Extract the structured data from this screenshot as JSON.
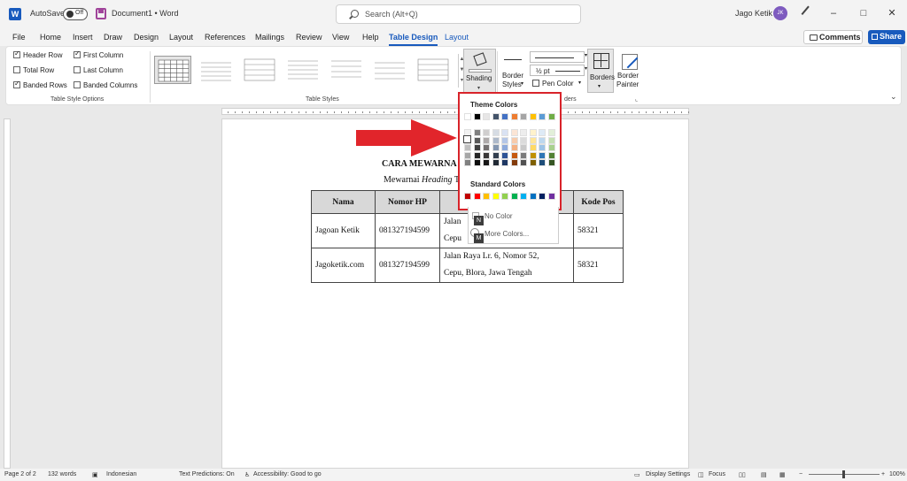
{
  "titlebar": {
    "app_logo": "W",
    "autosave_label": "AutoSave",
    "autosave_state": "Off",
    "document_title": "Document1 • Word",
    "search_placeholder": "Search (Alt+Q)",
    "user_name": "Jago Ketik",
    "user_initials": "JK",
    "minimize": "–",
    "maximize": "□",
    "close": "✕"
  },
  "tabs": [
    "File",
    "Home",
    "Insert",
    "Draw",
    "Design",
    "Layout",
    "References",
    "Mailings",
    "Review",
    "View",
    "Help",
    "Table Design",
    "Layout"
  ],
  "active_tab": "Table Design",
  "comments_label": "Comments",
  "share_label": "Share",
  "ribbon": {
    "style_options": {
      "items": [
        {
          "label": "Header Row",
          "checked": true
        },
        {
          "label": "Total Row",
          "checked": false
        },
        {
          "label": "Banded Rows",
          "checked": true
        },
        {
          "label": "First Column",
          "checked": true
        },
        {
          "label": "Last Column",
          "checked": false
        },
        {
          "label": "Banded Columns",
          "checked": false
        }
      ],
      "group_label": "Table Style Options"
    },
    "table_styles_label": "Table Styles",
    "shading_label": "Shading",
    "border_styles_label": "Border Styles",
    "border_styles_line1": "Border",
    "border_styles_line2": "Styles",
    "pen_weight": "½ pt",
    "pen_color_label": "Pen Color",
    "borders_label": "Borders",
    "border_painter_line1": "Border",
    "border_painter_line2": "Painter",
    "borders_group_label": "ders"
  },
  "color_menu": {
    "theme_colors_label": "Theme Colors",
    "standard_colors_label": "Standard Colors",
    "no_color_label": "No Color",
    "more_colors_label": "More Colors...",
    "keytip_n": "N",
    "keytip_m": "M",
    "theme_top_row": [
      "#ffffff",
      "#000000",
      "#e7e6e6",
      "#44546a",
      "#4472c4",
      "#ed7d31",
      "#a5a5a5",
      "#ffc000",
      "#5b9bd5",
      "#70ad47"
    ],
    "theme_columns": [
      [
        "#f2f2f2",
        "#d9d9d9",
        "#bfbfbf",
        "#a6a6a6",
        "#808080"
      ],
      [
        "#7f7f7f",
        "#595959",
        "#404040",
        "#262626",
        "#0d0d0d"
      ],
      [
        "#d0cece",
        "#aeaaaa",
        "#757171",
        "#3a3838",
        "#171616"
      ],
      [
        "#d6dce4",
        "#adb9ca",
        "#8496b0",
        "#333f4f",
        "#222a35"
      ],
      [
        "#d9e2f3",
        "#b4c6e7",
        "#8eaadb",
        "#2f5496",
        "#1f3864"
      ],
      [
        "#fbe5d5",
        "#f7cbac",
        "#f4b183",
        "#c55a11",
        "#833c0b"
      ],
      [
        "#ededed",
        "#dbdbdb",
        "#c9c9c9",
        "#7b7b7b",
        "#525252"
      ],
      [
        "#fff2cc",
        "#fee599",
        "#ffd965",
        "#bf9000",
        "#7f6000"
      ],
      [
        "#deeaf6",
        "#bdd7ee",
        "#9dc3e6",
        "#2e75b5",
        "#1f4e79"
      ],
      [
        "#e2efd9",
        "#c5e0b3",
        "#a8d08d",
        "#538135",
        "#375623"
      ]
    ],
    "standard_row": [
      "#c00000",
      "#ff0000",
      "#ffc000",
      "#ffff00",
      "#92d050",
      "#00b050",
      "#00b0f0",
      "#0070c0",
      "#002060",
      "#7030a0"
    ],
    "highlight_color": "#d8232a"
  },
  "document": {
    "heading": "CARA MEWARNA",
    "subtitle_prefix": "Mewarnai ",
    "subtitle_italic": "Heading",
    "subtitle_suffix": " T",
    "table": {
      "headers": [
        "Nama",
        "Nomor HP",
        "",
        "Kode Pos"
      ],
      "rows": [
        {
          "nama": "Jagoan Ketik",
          "hp": "081327194599",
          "alamat_1": "Jalan",
          "alamat_2": "Cepu",
          "kode": "58321"
        },
        {
          "nama": "Jagoketik.com",
          "hp": "081327194599",
          "alamat_1": "Jalan Raya Lr. 6, Nomor 52,",
          "alamat_2": "Cepu, Blora, Jawa Tengah",
          "kode": "58321"
        }
      ]
    }
  },
  "statusbar": {
    "page": "Page 2 of 2",
    "words": "132 words",
    "language": "Indonesian",
    "text_predictions": "Text Predictions: On",
    "accessibility": "Accessibility: Good to go",
    "display_settings": "Display Settings",
    "focus": "Focus",
    "zoom": "100%"
  },
  "colors": {
    "accent": "#185abd",
    "arrow": "#e1252b"
  }
}
